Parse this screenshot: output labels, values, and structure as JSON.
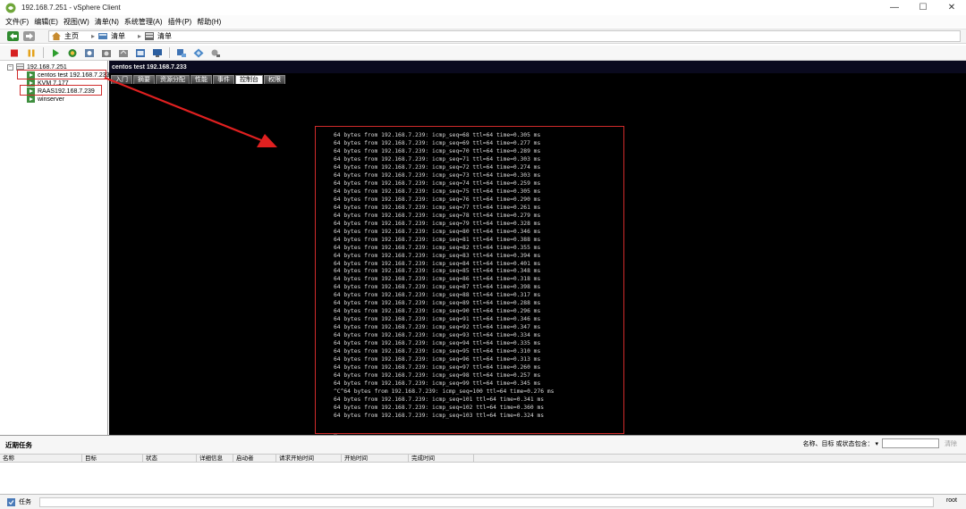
{
  "window": {
    "title": "192.168.7.251 - vSphere Client",
    "controls": {
      "minimize": "—",
      "maximize": "☐",
      "close": "✕"
    }
  },
  "menu": {
    "items": [
      "文件(F)",
      "编辑(E)",
      "视图(W)",
      "清单(N)",
      "系统管理(A)",
      "插件(P)",
      "帮助(H)"
    ]
  },
  "nav": {
    "breadcrumb": [
      "主页",
      "清单",
      "清单"
    ]
  },
  "tree": {
    "host": "192.168.7.251",
    "vms": [
      "centos test 192.168.7.233",
      "KVM 7.177",
      "RAAS192.168.7.239",
      "winserver"
    ]
  },
  "panel": {
    "title": "centos test 192.168.7.233",
    "tabs": [
      "入门",
      "摘要",
      "资源分配",
      "性能",
      "事件",
      "控制台",
      "权限"
    ],
    "active_tab": "控制台"
  },
  "console": {
    "lines": [
      "64 bytes from 192.168.7.239: icmp_seq=68 ttl=64 time=0.305 ms",
      "64 bytes from 192.168.7.239: icmp_seq=69 ttl=64 time=0.277 ms",
      "64 bytes from 192.168.7.239: icmp_seq=70 ttl=64 time=0.289 ms",
      "64 bytes from 192.168.7.239: icmp_seq=71 ttl=64 time=0.303 ms",
      "64 bytes from 192.168.7.239: icmp_seq=72 ttl=64 time=0.274 ms",
      "64 bytes from 192.168.7.239: icmp_seq=73 ttl=64 time=0.303 ms",
      "64 bytes from 192.168.7.239: icmp_seq=74 ttl=64 time=0.259 ms",
      "64 bytes from 192.168.7.239: icmp_seq=75 ttl=64 time=0.305 ms",
      "64 bytes from 192.168.7.239: icmp_seq=76 ttl=64 time=0.290 ms",
      "64 bytes from 192.168.7.239: icmp_seq=77 ttl=64 time=0.261 ms",
      "64 bytes from 192.168.7.239: icmp_seq=78 ttl=64 time=0.279 ms",
      "64 bytes from 192.168.7.239: icmp_seq=79 ttl=64 time=0.328 ms",
      "64 bytes from 192.168.7.239: icmp_seq=80 ttl=64 time=0.346 ms",
      "64 bytes from 192.168.7.239: icmp_seq=81 ttl=64 time=0.388 ms",
      "64 bytes from 192.168.7.239: icmp_seq=82 ttl=64 time=0.355 ms",
      "64 bytes from 192.168.7.239: icmp_seq=83 ttl=64 time=0.394 ms",
      "64 bytes from 192.168.7.239: icmp_seq=84 ttl=64 time=0.401 ms",
      "64 bytes from 192.168.7.239: icmp_seq=85 ttl=64 time=0.348 ms",
      "64 bytes from 192.168.7.239: icmp_seq=86 ttl=64 time=0.318 ms",
      "64 bytes from 192.168.7.239: icmp_seq=87 ttl=64 time=0.398 ms",
      "64 bytes from 192.168.7.239: icmp_seq=88 ttl=64 time=0.317 ms",
      "64 bytes from 192.168.7.239: icmp_seq=89 ttl=64 time=0.288 ms",
      "64 bytes from 192.168.7.239: icmp_seq=90 ttl=64 time=0.296 ms",
      "64 bytes from 192.168.7.239: icmp_seq=91 ttl=64 time=0.346 ms",
      "64 bytes from 192.168.7.239: icmp_seq=92 ttl=64 time=0.347 ms",
      "64 bytes from 192.168.7.239: icmp_seq=93 ttl=64 time=0.334 ms",
      "64 bytes from 192.168.7.239: icmp_seq=94 ttl=64 time=0.335 ms",
      "64 bytes from 192.168.7.239: icmp_seq=95 ttl=64 time=0.310 ms",
      "64 bytes from 192.168.7.239: icmp_seq=96 ttl=64 time=0.313 ms",
      "64 bytes from 192.168.7.239: icmp_seq=97 ttl=64 time=0.260 ms",
      "64 bytes from 192.168.7.239: icmp_seq=98 ttl=64 time=0.257 ms",
      "64 bytes from 192.168.7.239: icmp_seq=99 ttl=64 time=0.345 ms",
      "^C^64 bytes from 192.168.7.239: icmp_seq=100 ttl=64 time=0.276 ms",
      "64 bytes from 192.168.7.239: icmp_seq=101 ttl=64 time=0.341 ms",
      "64 bytes from 192.168.7.239: icmp_seq=102 ttl=64 time=0.360 ms",
      "64 bytes from 192.168.7.239: icmp_seq=103 ttl=64 time=0.324 ms",
      "",
      "_"
    ]
  },
  "tasks": {
    "title": "近期任务",
    "filter_label": "名称、目标 或状态包含：",
    "filter_value": "",
    "clear_label": "清除",
    "columns": [
      "名称",
      "目标",
      "状态",
      "详细信息",
      "启动者",
      "请求开始时间",
      "开始时间",
      "完成时间"
    ]
  },
  "status": {
    "tasks_label": "任务",
    "user": "root"
  },
  "colors": {
    "highlight": "#d12b2b",
    "console_bg": "#000000",
    "console_text": "#d9d9d9"
  }
}
